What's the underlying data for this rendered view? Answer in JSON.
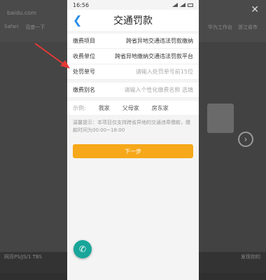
{
  "browser": {
    "url": "baidu.com",
    "bookmarks_left": [
      "Safari",
      "百度一下"
    ],
    "bookmarks_right": [
      "华为工作台",
      "浙江省市"
    ],
    "bottom_left": "网页PS/JS/1 TBS",
    "bottom_right": "发现你的"
  },
  "status": {
    "time": "16:56"
  },
  "header": {
    "title": "交通罚款"
  },
  "form": {
    "rows": [
      {
        "label": "缴费项目",
        "value": "跨省异地交通违法罚款缴纳",
        "placeholder": ""
      },
      {
        "label": "收费单位",
        "value": "跨省异地缴纳交通违法罚款平台",
        "placeholder": ""
      },
      {
        "label": "处罚单号",
        "value": "",
        "placeholder": "请输入处罚单号前15位"
      },
      {
        "label": "缴费别名",
        "value": "",
        "placeholder": "请输入个性化缴费名称 选填"
      }
    ],
    "examples": {
      "label": "示例:",
      "items": [
        "我家",
        "父母家",
        "房东家"
      ]
    },
    "tip": "温馨提示：本项目仅支持跨省异地的交通违章缴款，缴款时间为00:00~18:00",
    "next_label": "下一步"
  },
  "colors": {
    "accent": "#2a8ee8",
    "button": "#f6a81a",
    "chat": "#18a69a",
    "arrow": "#e53935"
  }
}
